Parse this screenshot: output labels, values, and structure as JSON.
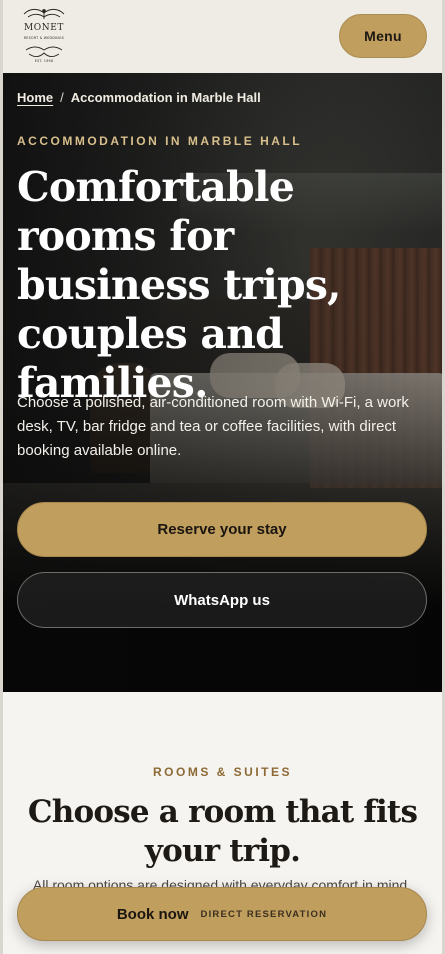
{
  "header": {
    "logo": {
      "name": "MONET",
      "tagline": "RESORT & WEDDINGS",
      "established": "EST. 1998"
    },
    "menu_label": "Menu"
  },
  "hero": {
    "breadcrumb": {
      "home": "Home",
      "separator": "/",
      "current": "Accommodation in Marble Hall"
    },
    "eyebrow": "ACCOMMODATION IN MARBLE HALL",
    "title": "Comfortable rooms for business trips, couples and families.",
    "text": "Choose a polished, air-conditioned room with Wi-Fi, a work desk, TV, bar fridge and tea or coffee facilities, with direct booking available online.",
    "reserve_label": "Reserve your stay",
    "whatsapp_label": "WhatsApp us"
  },
  "rooms": {
    "eyebrow": "ROOMS & SUITES",
    "title": "Choose a room that fits your trip.",
    "text": "All room options are designed with everyday comfort in mind, including Wi-Fi, TV, bar fridge and tea/coffee facilities."
  },
  "book_bar": {
    "label": "Book now",
    "sublabel": "DIRECT RESERVATION"
  },
  "colors": {
    "accent_gold": "#c09e5e",
    "eyebrow_gold": "#d8bf8c",
    "section_eyebrow": "#8d6a35",
    "header_bg": "#efece6"
  }
}
